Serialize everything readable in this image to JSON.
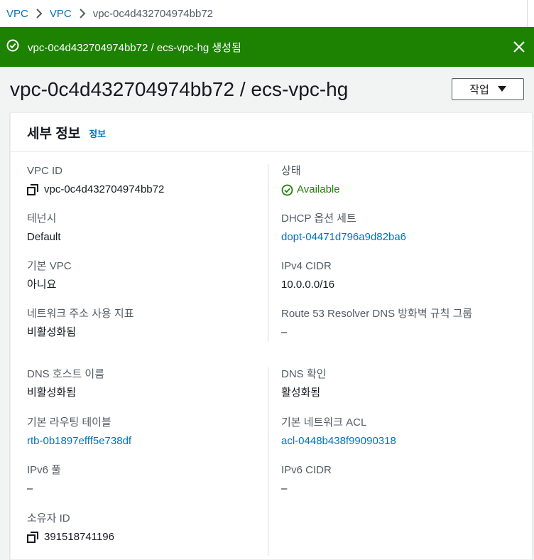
{
  "breadcrumb": {
    "items": [
      "VPC",
      "VPC"
    ],
    "current": "vpc-0c4d432704974bb72"
  },
  "flash": {
    "message": "vpc-0c4d432704974bb72 / ecs-vpc-hg 생성됨",
    "color": "#1d8102"
  },
  "page": {
    "title": "vpc-0c4d432704974bb72 / ecs-vpc-hg",
    "action_label": "작업"
  },
  "details": {
    "header": "세부 정보",
    "info_link": "정보",
    "left": [
      {
        "label": "VPC ID",
        "value": "vpc-0c4d432704974bb72"
      },
      {
        "label": "테넌시",
        "value": "Default"
      },
      {
        "label": "기본 VPC",
        "value": "아니요"
      },
      {
        "label": "네트워크 주소 사용 지표",
        "value": "비활성화됨"
      },
      {
        "label": "DNS 호스트 이름",
        "value": "비활성화됨"
      },
      {
        "label": "기본 라우팅 테이블",
        "value": "rtb-0b1897efff5e738df"
      },
      {
        "label": "IPv6 풀",
        "value": "–"
      },
      {
        "label": "소유자 ID",
        "value": "391518741196"
      }
    ],
    "right": [
      {
        "label": "상태",
        "value": "Available"
      },
      {
        "label": "DHCP 옵션 세트",
        "value": "dopt-04471d796a9d82ba6"
      },
      {
        "label": "IPv4 CIDR",
        "value": "10.0.0.0/16"
      },
      {
        "label": "Route 53 Resolver DNS 방화벽 규칙 그룹",
        "value": "–"
      },
      {
        "label": "DNS 확인",
        "value": "활성화됨"
      },
      {
        "label": "기본 네트워크 ACL",
        "value": "acl-0448b438f99090318"
      },
      {
        "label": "IPv6 CIDR",
        "value": "–"
      }
    ]
  },
  "colors": {
    "link": "#0073bb",
    "success": "#1d8102",
    "label": "#545b64"
  }
}
